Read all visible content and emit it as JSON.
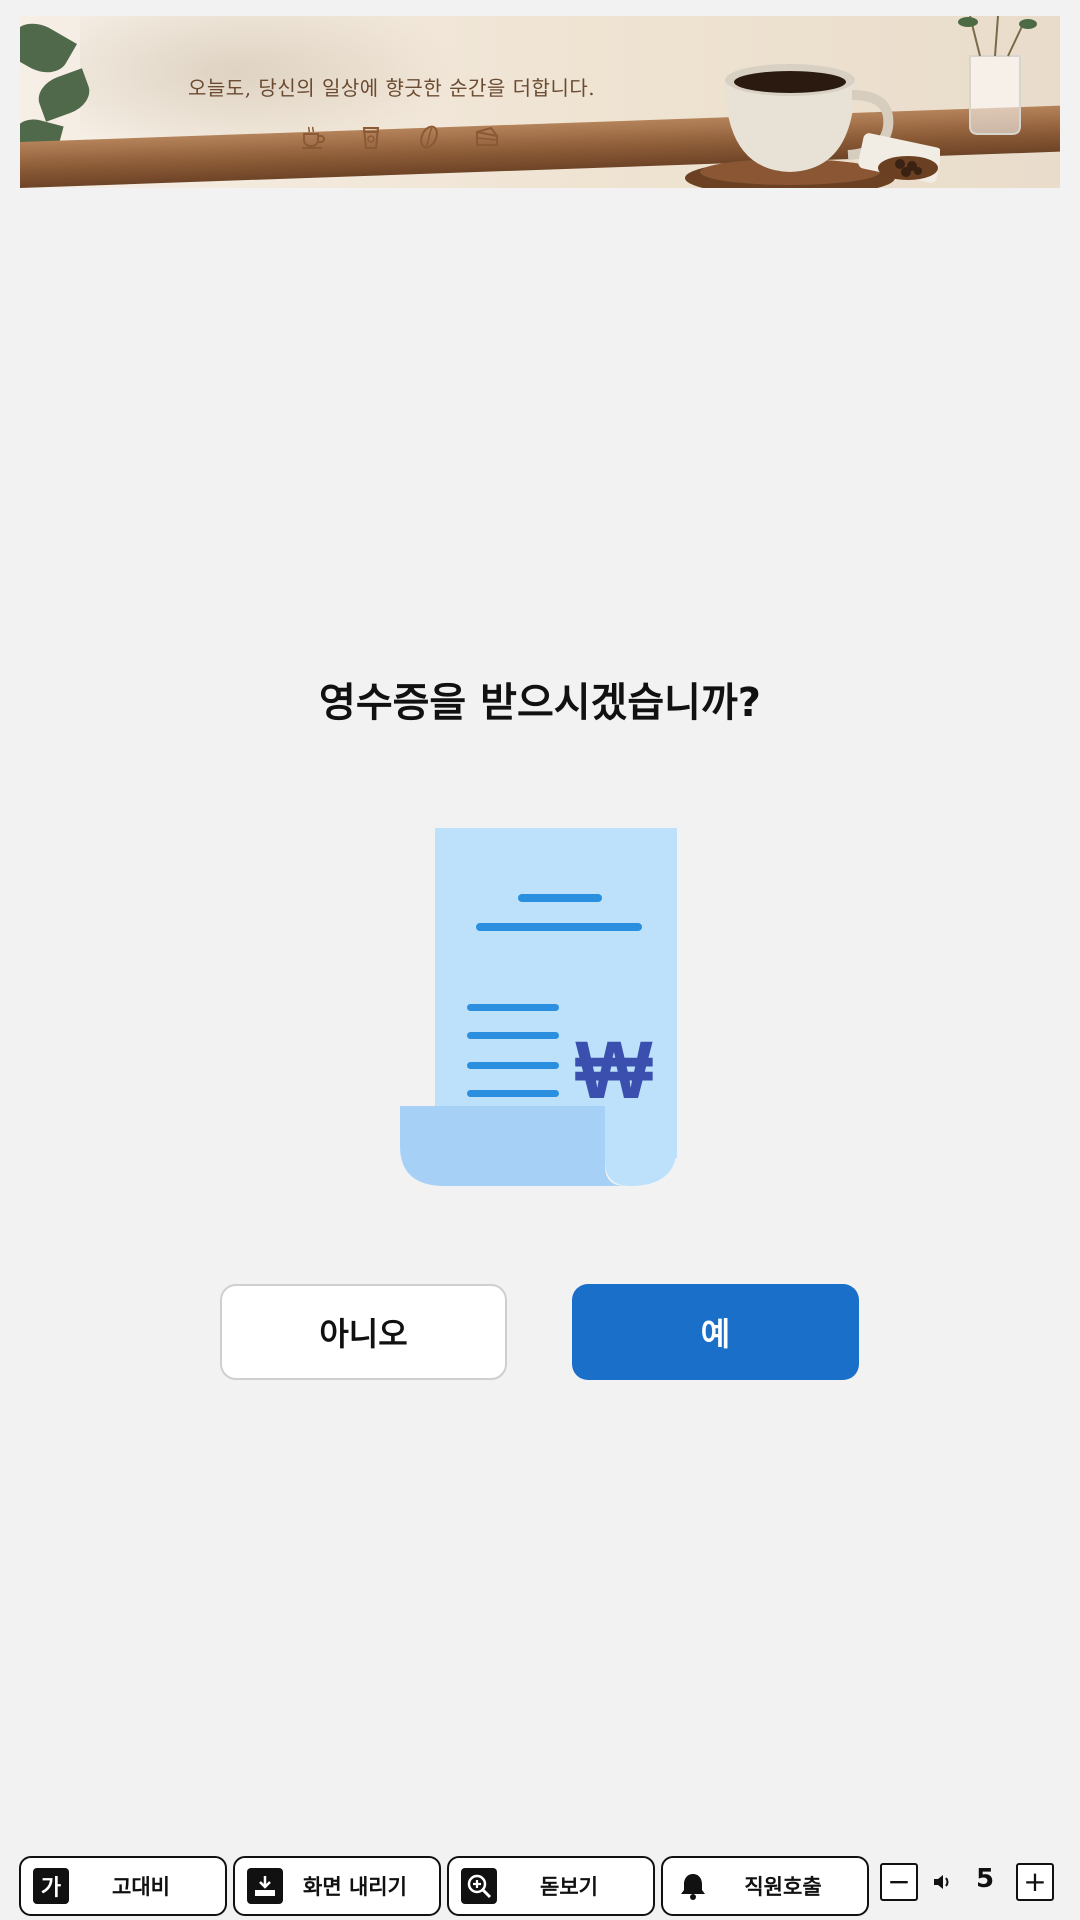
{
  "banner": {
    "tagline": "오늘도, 당신의 일상에 향긋한 순간을 더합니다.",
    "icons": [
      "coffee-cup-icon",
      "takeout-cup-icon",
      "coffee-bean-icon",
      "cake-icon"
    ]
  },
  "dialog": {
    "question": "영수증을 받으시겠습니까?",
    "receipt_symbol": "₩",
    "no_label": "아니오",
    "yes_label": "예"
  },
  "toolbar": {
    "contrast_icon_text": "가",
    "contrast_label": "고대비",
    "lower_label": "화면 내리기",
    "magnifier_label": "돋보기",
    "call_label": "직원호출",
    "volume_minus": "−",
    "volume_plus": "+",
    "volume_value": "5"
  },
  "colors": {
    "background": "#f2f2f2",
    "accent": "#1a6fc9",
    "receipt_paper": "#bde1fb",
    "receipt_lines": "#2b8fe0",
    "won_symbol": "#3a4fae"
  }
}
